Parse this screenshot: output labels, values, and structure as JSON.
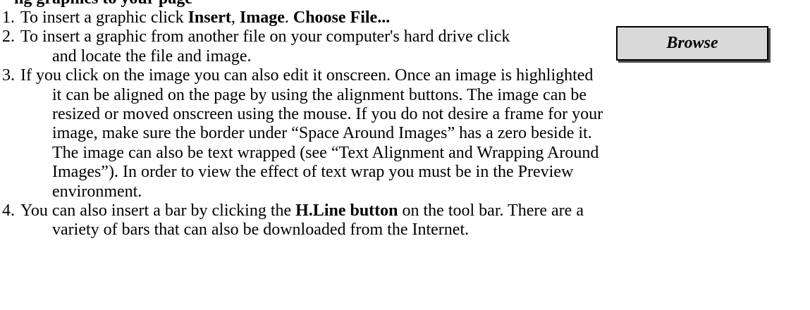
{
  "title_fragment": "ng graphics to your page",
  "items": [
    {
      "num": "1.",
      "lines": [
        [
          {
            "t": "To insert a graphic click "
          },
          {
            "t": "Insert",
            "b": true
          },
          {
            "t": ", "
          },
          {
            "t": "Image",
            "b": true
          },
          {
            "t": ". "
          },
          {
            "t": "Choose File...",
            "b": true
          }
        ]
      ]
    },
    {
      "num": "2.",
      "lines": [
        [
          {
            "t": " To insert a graphic from another file on your computer's hard drive click"
          }
        ],
        [
          {
            "t": "and locate the file and image."
          }
        ]
      ]
    },
    {
      "num": "3.",
      "lines": [
        [
          {
            "t": "If you click on the image you can also edit it onscreen.  Once an image is highlighted"
          }
        ],
        [
          {
            "t": "it can be aligned on the page by using the alignment buttons. The image can be"
          }
        ],
        [
          {
            "t": "resized or moved onscreen using the mouse. If you do not desire a frame for your"
          }
        ],
        [
          {
            "t": "image, make sure the border under “Space Around Images” has a zero beside it."
          }
        ],
        [
          {
            "t": "The image can also be text wrapped (see “Text Alignment and Wrapping Around"
          }
        ],
        [
          {
            "t": "Images”).  In order to view the effect of text wrap you must be in the Preview"
          }
        ],
        [
          {
            "t": "environment."
          }
        ]
      ]
    },
    {
      "num": "4.",
      "lines": [
        [
          {
            "t": "You can also insert a bar by clicking the "
          },
          {
            "t": "H.Line button",
            "b": true
          },
          {
            "t": " on the tool bar.  There are a"
          }
        ],
        [
          {
            "t": "variety of bars that can also be downloaded from the Internet."
          }
        ]
      ]
    }
  ],
  "browse_button": {
    "label": "Browse"
  }
}
